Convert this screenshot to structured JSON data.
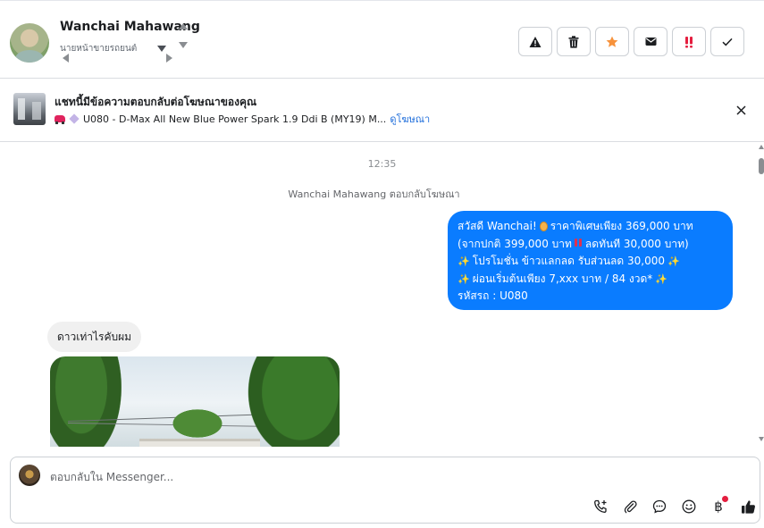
{
  "header": {
    "contact_name": "Wanchai Mahawang",
    "subtitle": "นายหน้าขายรถยนต์",
    "actions": [
      {
        "name": "report-icon",
        "label": "Report"
      },
      {
        "name": "trash-icon",
        "label": "Delete"
      },
      {
        "name": "star-icon",
        "label": "Star",
        "color": "#f7923b"
      },
      {
        "name": "envelope-icon",
        "label": "Mark unread"
      },
      {
        "name": "priority-icon",
        "label": "Priority",
        "color": "#e41e3f"
      },
      {
        "name": "check-icon",
        "label": "Done"
      }
    ]
  },
  "banner": {
    "title": "แชทนี้มีข้อความตอบกลับต่อโฆษณาของคุณ",
    "ad_text": "U080 - D-Max All New Blue Power Spark 1.9 Ddi B (MY19) M...",
    "link": "ดูโฆษณา"
  },
  "messages": {
    "time": "12:35",
    "system": "Wanchai Mahawang ตอบกลับโฆษณา",
    "outgoing": {
      "line1_a": "สวัสดี Wanchai!",
      "line1_b": "ราคาพิเศษเพียง 369,000 บาท",
      "line2_a": "(จากปกติ 399,000 บาท",
      "line2_b": "ลดทันที 30,000 บาท)",
      "line3": "โปรโมชั่น ข้าวแลกลด รับส่วนลด 30,000",
      "line4": "ผ่อนเริ่มต้นเพียง 7,xxx บาท / 84 งวด*",
      "line5": "รหัสรถ : U080",
      "bubble_color": "#0a7cff"
    },
    "incoming": {
      "text": "ดาวเท่าไรคับผม"
    }
  },
  "composer": {
    "placeholder": "ตอบกลับใน Messenger...",
    "tools": [
      "call-add-icon",
      "paperclip-icon",
      "chat-bubble-icon",
      "smiley-icon",
      "baht-icon",
      "thumbs-up-icon"
    ],
    "baht_symbol": "฿"
  }
}
